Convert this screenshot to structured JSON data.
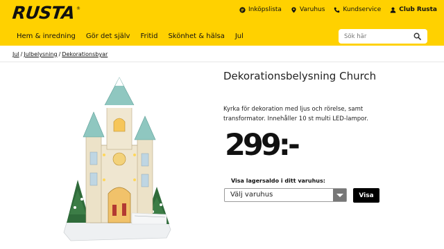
{
  "brand": {
    "logo_text": "RUSTA",
    "registered": "®"
  },
  "colors": {
    "header_bg": "#ffd100",
    "button_bg": "#000000",
    "text": "#222222"
  },
  "top_links": [
    {
      "label": "Inköpslista",
      "icon": "shopping-list-icon"
    },
    {
      "label": "Varuhus",
      "icon": "location-pin-icon"
    },
    {
      "label": "Kundservice",
      "icon": "phone-icon"
    },
    {
      "label": "Club Rusta",
      "icon": "user-icon"
    }
  ],
  "nav": [
    "Hem & inredning",
    "Gör det själv",
    "Fritid",
    "Skönhet & hälsa",
    "Jul"
  ],
  "search": {
    "placeholder": "Sök här"
  },
  "breadcrumb": [
    "Jul",
    "Julbelysning",
    "Dekorationsbyar"
  ],
  "product": {
    "title": "Dekorationsbelysning Church",
    "description": "Kyrka för dekoration med ljus och rörelse, samt transformator. Innehåller 10 st multi LED-lampor.",
    "price": "299:-",
    "stock_label": "Visa lagersaldo i ditt varuhus:",
    "store_select_value": "Välj varuhus",
    "show_button": "Visa",
    "image_alt": "church-decoration"
  }
}
